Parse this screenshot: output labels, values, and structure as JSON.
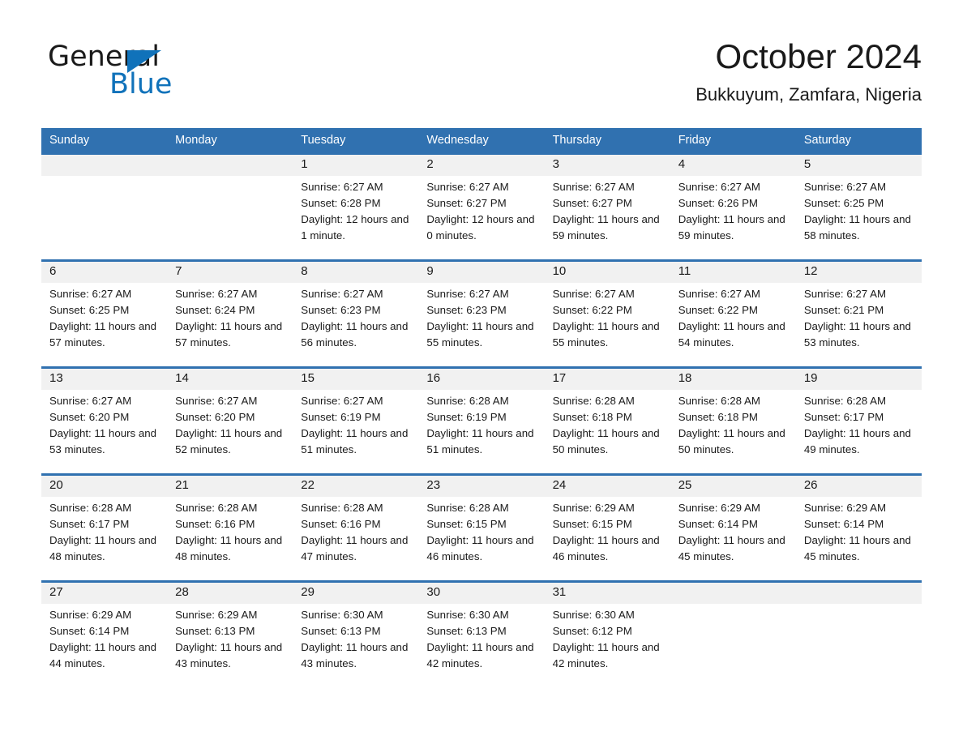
{
  "brand": {
    "name_part1": "General",
    "name_part2": "Blue",
    "triangle_color": "#1072ba"
  },
  "header": {
    "title": "October 2024",
    "subtitle": "Bukkuyum, Zamfara, Nigeria"
  },
  "theme": {
    "header_blue": "#3071b0",
    "day_band_gray": "#f1f1f1",
    "text_color": "#1a1a1a",
    "page_background": "#ffffff"
  },
  "weekdays": [
    "Sunday",
    "Monday",
    "Tuesday",
    "Wednesday",
    "Thursday",
    "Friday",
    "Saturday"
  ],
  "weeks": [
    [
      {
        "day": "",
        "sunrise": "",
        "sunset": "",
        "daylight": "",
        "empty": true
      },
      {
        "day": "",
        "sunrise": "",
        "sunset": "",
        "daylight": "",
        "empty": true
      },
      {
        "day": "1",
        "sunrise": "Sunrise: 6:27 AM",
        "sunset": "Sunset: 6:28 PM",
        "daylight": "Daylight: 12 hours and 1 minute."
      },
      {
        "day": "2",
        "sunrise": "Sunrise: 6:27 AM",
        "sunset": "Sunset: 6:27 PM",
        "daylight": "Daylight: 12 hours and 0 minutes."
      },
      {
        "day": "3",
        "sunrise": "Sunrise: 6:27 AM",
        "sunset": "Sunset: 6:27 PM",
        "daylight": "Daylight: 11 hours and 59 minutes."
      },
      {
        "day": "4",
        "sunrise": "Sunrise: 6:27 AM",
        "sunset": "Sunset: 6:26 PM",
        "daylight": "Daylight: 11 hours and 59 minutes."
      },
      {
        "day": "5",
        "sunrise": "Sunrise: 6:27 AM",
        "sunset": "Sunset: 6:25 PM",
        "daylight": "Daylight: 11 hours and 58 minutes."
      }
    ],
    [
      {
        "day": "6",
        "sunrise": "Sunrise: 6:27 AM",
        "sunset": "Sunset: 6:25 PM",
        "daylight": "Daylight: 11 hours and 57 minutes."
      },
      {
        "day": "7",
        "sunrise": "Sunrise: 6:27 AM",
        "sunset": "Sunset: 6:24 PM",
        "daylight": "Daylight: 11 hours and 57 minutes."
      },
      {
        "day": "8",
        "sunrise": "Sunrise: 6:27 AM",
        "sunset": "Sunset: 6:23 PM",
        "daylight": "Daylight: 11 hours and 56 minutes."
      },
      {
        "day": "9",
        "sunrise": "Sunrise: 6:27 AM",
        "sunset": "Sunset: 6:23 PM",
        "daylight": "Daylight: 11 hours and 55 minutes."
      },
      {
        "day": "10",
        "sunrise": "Sunrise: 6:27 AM",
        "sunset": "Sunset: 6:22 PM",
        "daylight": "Daylight: 11 hours and 55 minutes."
      },
      {
        "day": "11",
        "sunrise": "Sunrise: 6:27 AM",
        "sunset": "Sunset: 6:22 PM",
        "daylight": "Daylight: 11 hours and 54 minutes."
      },
      {
        "day": "12",
        "sunrise": "Sunrise: 6:27 AM",
        "sunset": "Sunset: 6:21 PM",
        "daylight": "Daylight: 11 hours and 53 minutes."
      }
    ],
    [
      {
        "day": "13",
        "sunrise": "Sunrise: 6:27 AM",
        "sunset": "Sunset: 6:20 PM",
        "daylight": "Daylight: 11 hours and 53 minutes."
      },
      {
        "day": "14",
        "sunrise": "Sunrise: 6:27 AM",
        "sunset": "Sunset: 6:20 PM",
        "daylight": "Daylight: 11 hours and 52 minutes."
      },
      {
        "day": "15",
        "sunrise": "Sunrise: 6:27 AM",
        "sunset": "Sunset: 6:19 PM",
        "daylight": "Daylight: 11 hours and 51 minutes."
      },
      {
        "day": "16",
        "sunrise": "Sunrise: 6:28 AM",
        "sunset": "Sunset: 6:19 PM",
        "daylight": "Daylight: 11 hours and 51 minutes."
      },
      {
        "day": "17",
        "sunrise": "Sunrise: 6:28 AM",
        "sunset": "Sunset: 6:18 PM",
        "daylight": "Daylight: 11 hours and 50 minutes."
      },
      {
        "day": "18",
        "sunrise": "Sunrise: 6:28 AM",
        "sunset": "Sunset: 6:18 PM",
        "daylight": "Daylight: 11 hours and 50 minutes."
      },
      {
        "day": "19",
        "sunrise": "Sunrise: 6:28 AM",
        "sunset": "Sunset: 6:17 PM",
        "daylight": "Daylight: 11 hours and 49 minutes."
      }
    ],
    [
      {
        "day": "20",
        "sunrise": "Sunrise: 6:28 AM",
        "sunset": "Sunset: 6:17 PM",
        "daylight": "Daylight: 11 hours and 48 minutes."
      },
      {
        "day": "21",
        "sunrise": "Sunrise: 6:28 AM",
        "sunset": "Sunset: 6:16 PM",
        "daylight": "Daylight: 11 hours and 48 minutes."
      },
      {
        "day": "22",
        "sunrise": "Sunrise: 6:28 AM",
        "sunset": "Sunset: 6:16 PM",
        "daylight": "Daylight: 11 hours and 47 minutes."
      },
      {
        "day": "23",
        "sunrise": "Sunrise: 6:28 AM",
        "sunset": "Sunset: 6:15 PM",
        "daylight": "Daylight: 11 hours and 46 minutes."
      },
      {
        "day": "24",
        "sunrise": "Sunrise: 6:29 AM",
        "sunset": "Sunset: 6:15 PM",
        "daylight": "Daylight: 11 hours and 46 minutes."
      },
      {
        "day": "25",
        "sunrise": "Sunrise: 6:29 AM",
        "sunset": "Sunset: 6:14 PM",
        "daylight": "Daylight: 11 hours and 45 minutes."
      },
      {
        "day": "26",
        "sunrise": "Sunrise: 6:29 AM",
        "sunset": "Sunset: 6:14 PM",
        "daylight": "Daylight: 11 hours and 45 minutes."
      }
    ],
    [
      {
        "day": "27",
        "sunrise": "Sunrise: 6:29 AM",
        "sunset": "Sunset: 6:14 PM",
        "daylight": "Daylight: 11 hours and 44 minutes."
      },
      {
        "day": "28",
        "sunrise": "Sunrise: 6:29 AM",
        "sunset": "Sunset: 6:13 PM",
        "daylight": "Daylight: 11 hours and 43 minutes."
      },
      {
        "day": "29",
        "sunrise": "Sunrise: 6:30 AM",
        "sunset": "Sunset: 6:13 PM",
        "daylight": "Daylight: 11 hours and 43 minutes."
      },
      {
        "day": "30",
        "sunrise": "Sunrise: 6:30 AM",
        "sunset": "Sunset: 6:13 PM",
        "daylight": "Daylight: 11 hours and 42 minutes."
      },
      {
        "day": "31",
        "sunrise": "Sunrise: 6:30 AM",
        "sunset": "Sunset: 6:12 PM",
        "daylight": "Daylight: 11 hours and 42 minutes."
      },
      {
        "day": "",
        "sunrise": "",
        "sunset": "",
        "daylight": "",
        "empty": true
      },
      {
        "day": "",
        "sunrise": "",
        "sunset": "",
        "daylight": "",
        "empty": true
      }
    ]
  ]
}
